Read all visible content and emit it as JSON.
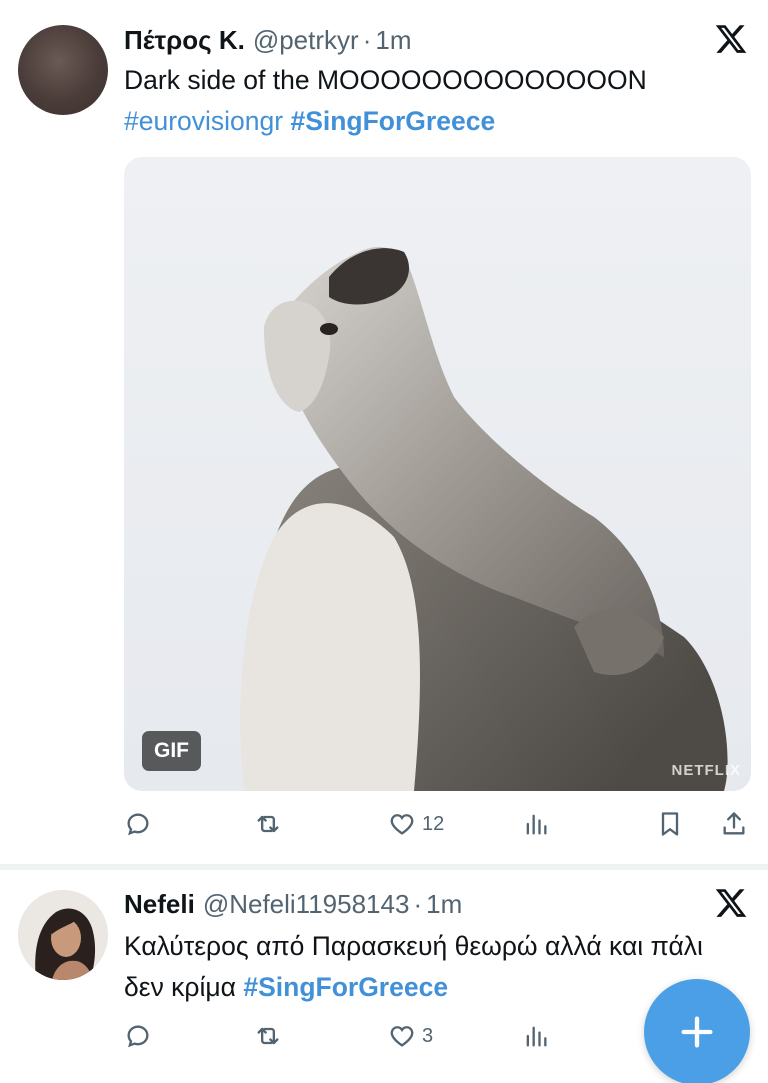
{
  "tweets": [
    {
      "display_name": "Πέτρος Κ.",
      "handle": "@petrkyr",
      "separator": "·",
      "time": "1m",
      "text": "Dark side of the MOOOOOOOOOOOOOON",
      "hashtags": [
        "#eurovisiongr",
        "#SingForGreece"
      ],
      "media_badge": "GIF",
      "media_watermark": "NETFLIX",
      "counts": {
        "reply": "",
        "retweet": "",
        "like": "12"
      }
    },
    {
      "display_name": "Nefeli",
      "handle": "@Nefeli11958143",
      "separator": "·",
      "time": "1m",
      "text": "Καλύτερος από Παρασκευή θεωρώ αλλά και πάλι δεν κρίμα",
      "hashtags": [
        "#SingForGreece"
      ],
      "counts": {
        "reply": "",
        "retweet": "",
        "like": "3"
      }
    }
  ],
  "icons": {
    "platform_logo": "x-logo-icon",
    "reply": "reply-icon",
    "retweet": "retweet-icon",
    "like": "heart-icon",
    "views": "views-icon",
    "bookmark": "bookmark-icon",
    "share": "share-icon",
    "compose": "plus-icon"
  },
  "colors": {
    "hashtag": "#4190d8",
    "secondary_text": "#536471",
    "fab": "#4a9fe6",
    "divider": "#eff3f4"
  }
}
